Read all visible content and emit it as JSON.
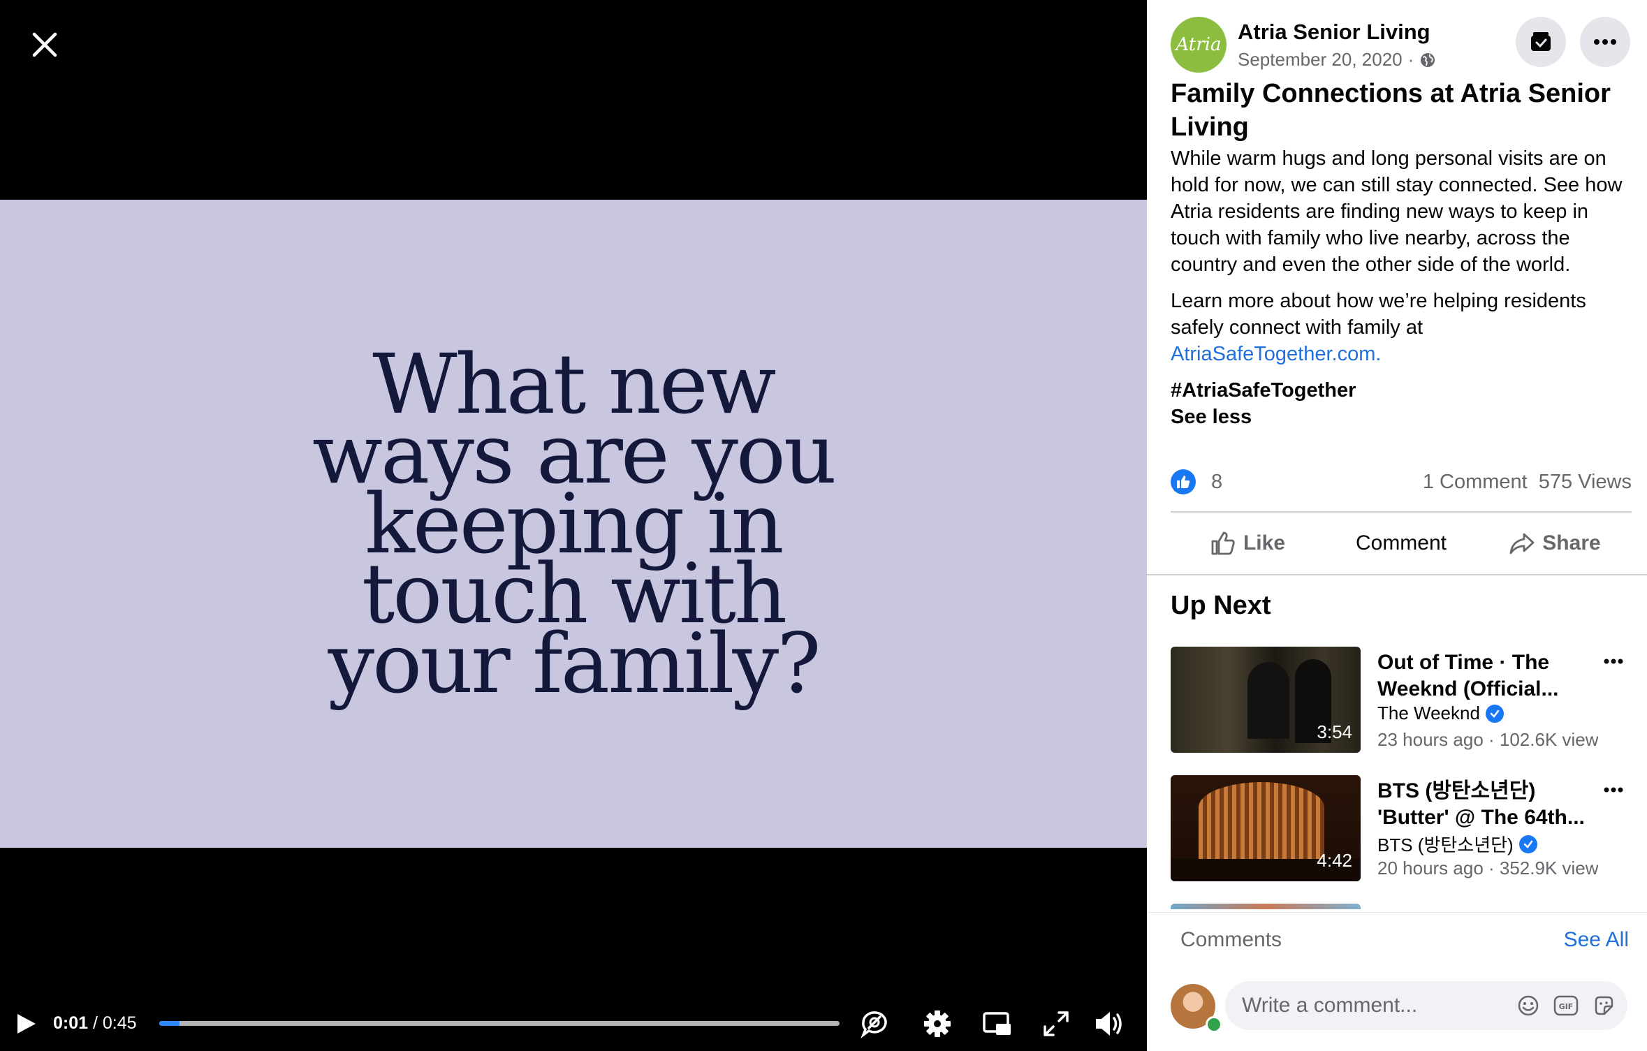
{
  "video": {
    "headline": "What new ways are you keeping in touch with your family?",
    "current_time": "0:01",
    "separator": "/",
    "duration": "0:45",
    "progress_fraction": 0.03
  },
  "post": {
    "page_name": "Atria Senior Living",
    "avatar_text": "Atria",
    "date": "September 20, 2020",
    "date_sep": "·",
    "title": "Family Connections at Atria Senior Living",
    "body_p1": "While warm hugs and long personal visits are on hold for now, we can still stay connected. See how Atria residents are finding new ways to keep in touch with family who live nearby, across the country and even the other side of the world.",
    "body_p2": "Learn more about how we’re helping residents safely connect with family at ",
    "link": "AtriaSafeTogether.com.",
    "hashtag": "#AtriaSafeTogether",
    "see_less": "See less",
    "like_count": "8",
    "comment_count": "1 Comment",
    "views": "575 Views",
    "actions": {
      "like": "Like",
      "comment": "Comment",
      "share": "Share"
    }
  },
  "up_next": {
    "heading": "Up Next",
    "items": [
      {
        "title": "Out of Time · The Weeknd (Official...",
        "channel": "The Weeknd",
        "meta": "23 hours ago · 102.6K views",
        "duration": "3:54"
      },
      {
        "title": "BTS (방탄소년단) 'Butter' @ The 64th...",
        "channel": "BTS (방탄소년단)",
        "meta": "20 hours ago · 352.9K views",
        "duration": "4:42"
      }
    ]
  },
  "comments": {
    "label": "Comments",
    "see_all": "See All",
    "placeholder": "Write a comment..."
  },
  "colors": {
    "accent": "#1877f2",
    "link": "#216fdb",
    "video_bg": "#c9c7df",
    "headline": "#14183a"
  }
}
